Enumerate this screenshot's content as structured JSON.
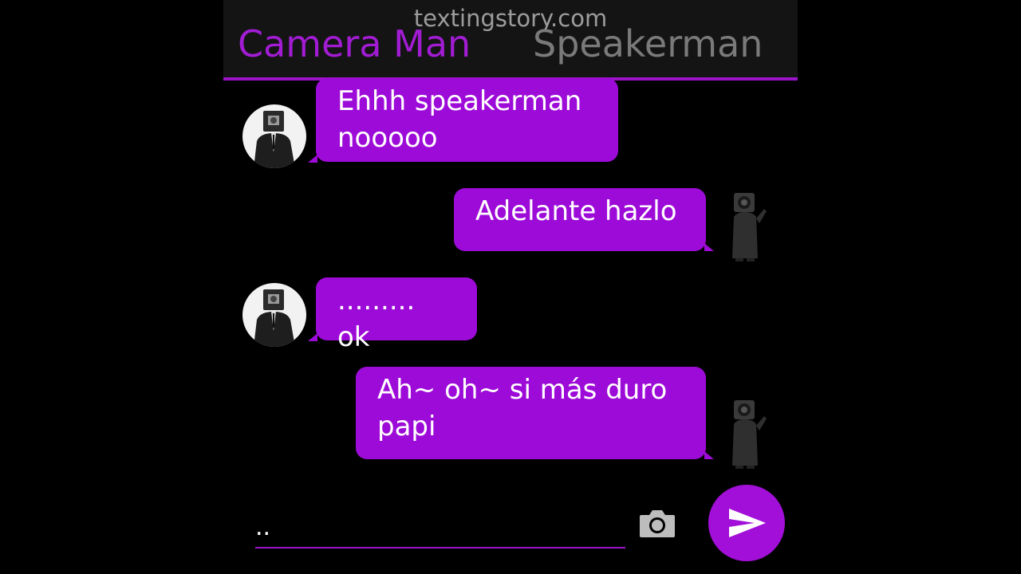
{
  "header": {
    "watermark": "textingstory.com",
    "left_contact": "Camera Man",
    "right_contact": "Speakerman"
  },
  "messages": [
    {
      "side": "left",
      "sender": "Camera Man",
      "lines": [
        "Ehhh speakerman",
        "nooooo"
      ]
    },
    {
      "side": "right",
      "sender": "Speakerman",
      "lines": [
        "Adelante hazlo"
      ]
    },
    {
      "side": "left",
      "sender": "Camera Man",
      "lines": [
        "......... ok"
      ]
    },
    {
      "side": "right",
      "sender": "Speakerman",
      "lines": [
        "Ah~ oh~ si más duro",
        "papi"
      ]
    }
  ],
  "composer": {
    "value": "..",
    "camera_icon": "camera-icon",
    "send_icon": "send-icon"
  },
  "colors": {
    "accent": "#9d0bd8",
    "header_bg": "#141414",
    "left_name": "#a11cd3",
    "right_name": "#7a7a7a"
  }
}
